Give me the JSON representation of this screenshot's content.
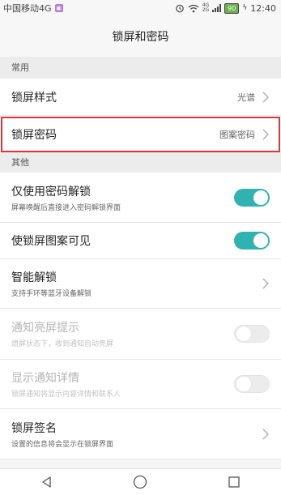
{
  "status_bar": {
    "carrier": "中国移动4G",
    "sim_badge": "▣",
    "net_top": "4G",
    "net_bottom": "2G",
    "battery": "90",
    "time": "12:40"
  },
  "header": {
    "title": "锁屏和密码"
  },
  "sections": {
    "common": {
      "label": "常用"
    },
    "other": {
      "label": "其他"
    }
  },
  "rows": {
    "lock_style": {
      "title": "锁屏样式",
      "value": "光谱"
    },
    "lock_password": {
      "title": "锁屏密码",
      "value": "图案密码"
    },
    "password_only": {
      "title": "仅使用密码解锁",
      "subtitle": "屏幕唤醒后直接进入密码解锁界面",
      "toggle": "on"
    },
    "pattern_visible": {
      "title": "使锁屏图案可见",
      "toggle": "on"
    },
    "smart_unlock": {
      "title": "智能解锁",
      "subtitle": "支持手环等蓝牙设备解锁"
    },
    "notify_wake": {
      "title": "通知亮屏提示",
      "subtitle": "熄屏状态下，收到通知自动亮屏",
      "toggle": "off",
      "disabled": true
    },
    "show_details": {
      "title": "显示通知详情",
      "subtitle": "锁屏通知将显示内容详情和联系人",
      "toggle": "off",
      "disabled": true
    },
    "lock_signature": {
      "title": "锁屏签名",
      "subtitle": "设置的信息将会显示在锁屏界面"
    }
  },
  "colors": {
    "accent": "#2fb3b0",
    "highlight": "#d9363e"
  },
  "icons": [
    "alarm-icon",
    "wifi-icon",
    "battery-icon",
    "chevron-right-icon",
    "back-icon",
    "home-icon",
    "recents-icon"
  ]
}
